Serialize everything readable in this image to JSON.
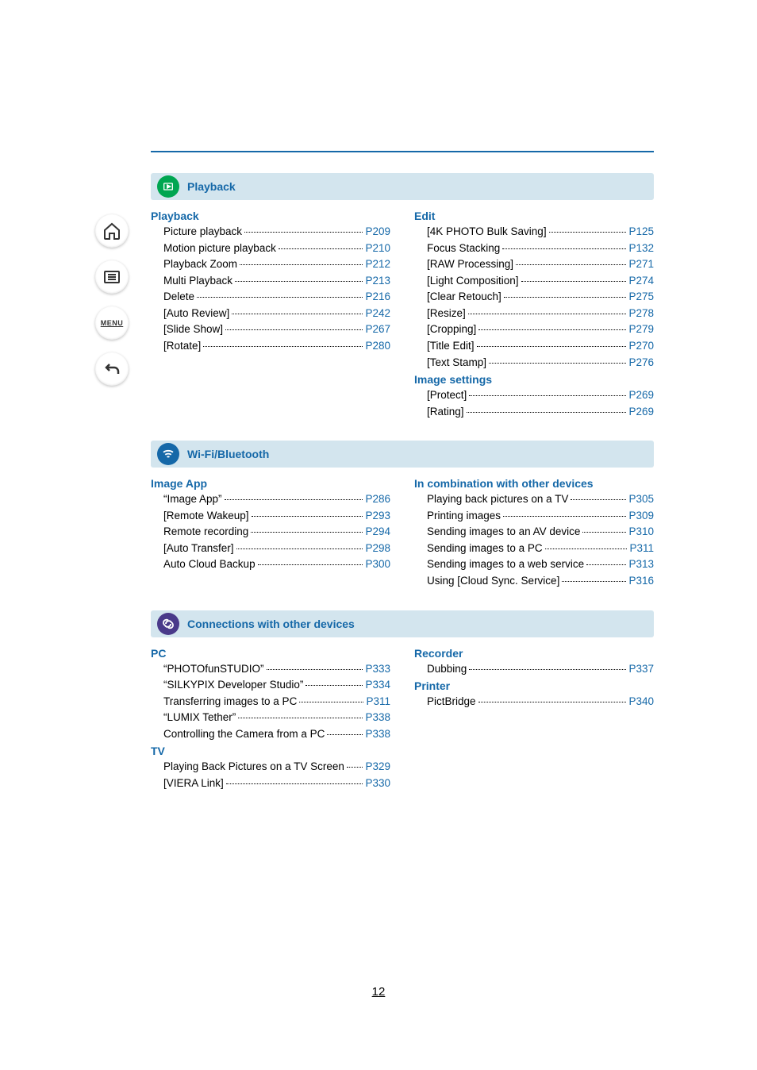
{
  "page_number": "12",
  "sections": [
    {
      "icon": "play",
      "icon_color": "green",
      "title": "Playback",
      "columns": [
        [
          {
            "heading": "Playback",
            "items": [
              {
                "label": "Picture playback",
                "page": "P209"
              },
              {
                "label": "Motion picture playback",
                "page": "P210"
              },
              {
                "label": "Playback Zoom",
                "page": "P212"
              },
              {
                "label": "Multi Playback",
                "page": "P213"
              },
              {
                "label": "Delete",
                "page": "P216"
              },
              {
                "label": "[Auto Review]",
                "page": "P242"
              },
              {
                "label": "[Slide Show]",
                "page": "P267"
              },
              {
                "label": "[Rotate]",
                "page": "P280"
              }
            ]
          }
        ],
        [
          {
            "heading": "Edit",
            "items": [
              {
                "label": "[4K PHOTO Bulk Saving]",
                "page": "P125"
              },
              {
                "label": "Focus Stacking",
                "page": "P132"
              },
              {
                "label": "[RAW Processing]",
                "page": "P271"
              },
              {
                "label": "[Light Composition]",
                "page": "P274"
              },
              {
                "label": "[Clear Retouch]",
                "page": "P275"
              },
              {
                "label": "[Resize]",
                "page": "P278"
              },
              {
                "label": "[Cropping]",
                "page": "P279"
              },
              {
                "label": "[Title Edit]",
                "page": "P270"
              },
              {
                "label": "[Text Stamp]",
                "page": "P276"
              }
            ]
          },
          {
            "heading": "Image settings",
            "items": [
              {
                "label": "[Protect]",
                "page": "P269"
              },
              {
                "label": "[Rating]",
                "page": "P269"
              }
            ]
          }
        ]
      ]
    },
    {
      "icon": "wifi",
      "icon_color": "blue",
      "title": "Wi-Fi/Bluetooth",
      "columns": [
        [
          {
            "heading": "Image App",
            "items": [
              {
                "label": "“Image App”",
                "page": "P286"
              },
              {
                "label": "[Remote Wakeup]",
                "page": "P293"
              },
              {
                "label": "Remote recording",
                "page": "P294"
              },
              {
                "label": "[Auto Transfer]",
                "page": "P298"
              },
              {
                "label": "Auto Cloud Backup",
                "page": "P300"
              }
            ]
          }
        ],
        [
          {
            "heading": "In combination with other devices",
            "items": [
              {
                "label": "Playing back pictures on a TV",
                "page": "P305"
              },
              {
                "label": "Printing images",
                "page": "P309"
              },
              {
                "label": "Sending images to an AV device",
                "page": "P310"
              },
              {
                "label": "Sending images to a PC",
                "page": "P311"
              },
              {
                "label": "Sending images to a web service",
                "page": "P313"
              },
              {
                "label": "Using [Cloud Sync. Service]",
                "page": "P316"
              }
            ]
          }
        ]
      ]
    },
    {
      "icon": "link",
      "icon_color": "purple",
      "title": "Connections with other devices",
      "columns": [
        [
          {
            "heading": "PC",
            "items": [
              {
                "label": "“PHOTOfunSTUDIO”",
                "page": "P333"
              },
              {
                "label": "“SILKYPIX Developer Studio”",
                "page": "P334"
              },
              {
                "label": "Transferring images to a PC",
                "page": "P311"
              },
              {
                "label": "“LUMIX Tether”",
                "page": "P338"
              },
              {
                "label": "Controlling the Camera from a PC",
                "page": "P338"
              }
            ]
          },
          {
            "heading": "TV",
            "items": [
              {
                "label": "Playing Back Pictures on a TV Screen",
                "page": "P329"
              },
              {
                "label": "[VIERA Link]",
                "page": "P330"
              }
            ]
          }
        ],
        [
          {
            "heading": "Recorder",
            "items": [
              {
                "label": "Dubbing",
                "page": "P337"
              }
            ]
          },
          {
            "heading": "Printer",
            "items": [
              {
                "label": "PictBridge",
                "page": "P340"
              }
            ]
          }
        ]
      ]
    }
  ]
}
